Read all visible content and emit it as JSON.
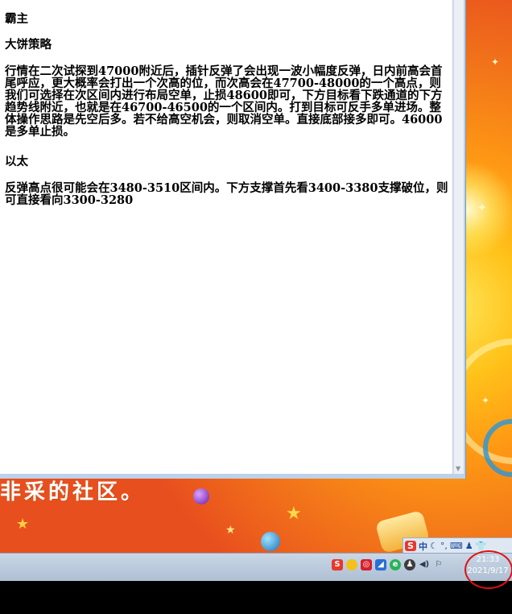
{
  "document": {
    "heading1": "霸主",
    "heading2": "大饼策略",
    "paragraph1": "行情在二次试探到47000附近后，插针反弹了会出现一波小幅度反弹，日内前高会首尾呼应，更大概率会打出一个次高的位，而次高会在47700-48000的一个高点，则我们可选择在次区间内进行布局空单，止损48600即可，下方目标看下跌通道的下方趋势线附近，也就是在46700-46500的一个区间内。打到目标可反手多单进场。整体操作思路是先空后多。若不给高空机会，则取消空单。直接底部接多即可。46000是多单止损。",
    "heading3": "以太",
    "paragraph2": "反弹高点很可能会在3480-3510区间内。下方支撑首先看3400-3380支撑破位，则可直接看向3300-3280"
  },
  "desktop": {
    "wallpaper_text": "非采的社区。"
  },
  "ime": {
    "logo": "S",
    "mode": "中"
  },
  "taskbar": {
    "time": "21:33",
    "date": "2021/9/17"
  },
  "colors": {
    "highlight_circle": "#e01010",
    "wallpaper": "#f06a1c"
  }
}
